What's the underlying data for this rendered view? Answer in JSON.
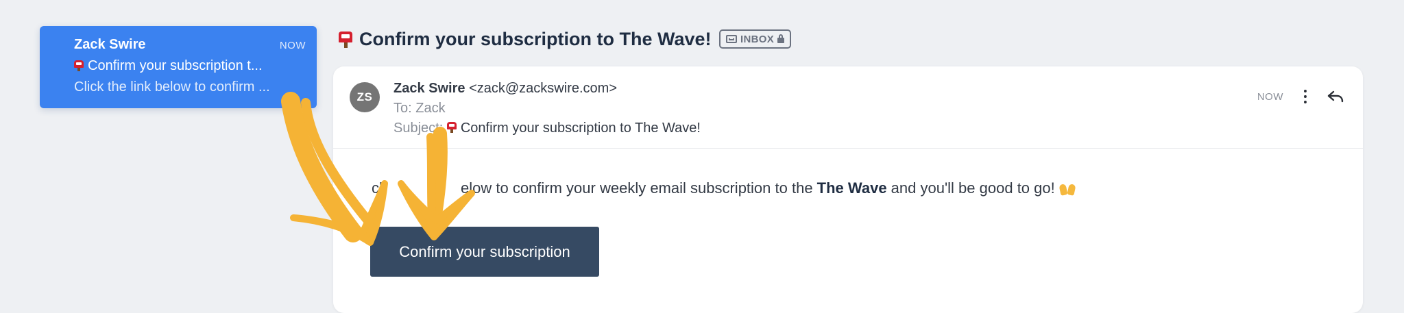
{
  "message_list": {
    "item": {
      "sender": "Zack Swire",
      "time": "NOW",
      "subject": "Confirm your subscription t...",
      "preview": "Click the link below to confirm ..."
    }
  },
  "email": {
    "title": "Confirm your subscription to The Wave!",
    "badge": "INBOX",
    "from_name": "Zack Swire",
    "from_email": "<zack@zackswire.com>",
    "to_line": "To: Zack",
    "subject_label": "Subject:",
    "subject_text": "Confirm your subscription to The Wave!",
    "time": "NOW",
    "avatar_initials": "ZS",
    "body": {
      "visible_start": "ck",
      "visible_mid": "elow to confirm your weekly email subscription to the ",
      "bold": "The Wave",
      "end": " and you'll be good to go!"
    },
    "button_label": "Confirm your subscription"
  },
  "colors": {
    "accent": "#3b82f0",
    "button": "#364a63",
    "annotation_arrows": "#f5b335",
    "mailbox": "#d5202e"
  },
  "icons": [
    "mailbox-icon",
    "tray-icon",
    "lock-icon",
    "more-vertical-icon",
    "reply-icon",
    "raising-hands-icon"
  ]
}
